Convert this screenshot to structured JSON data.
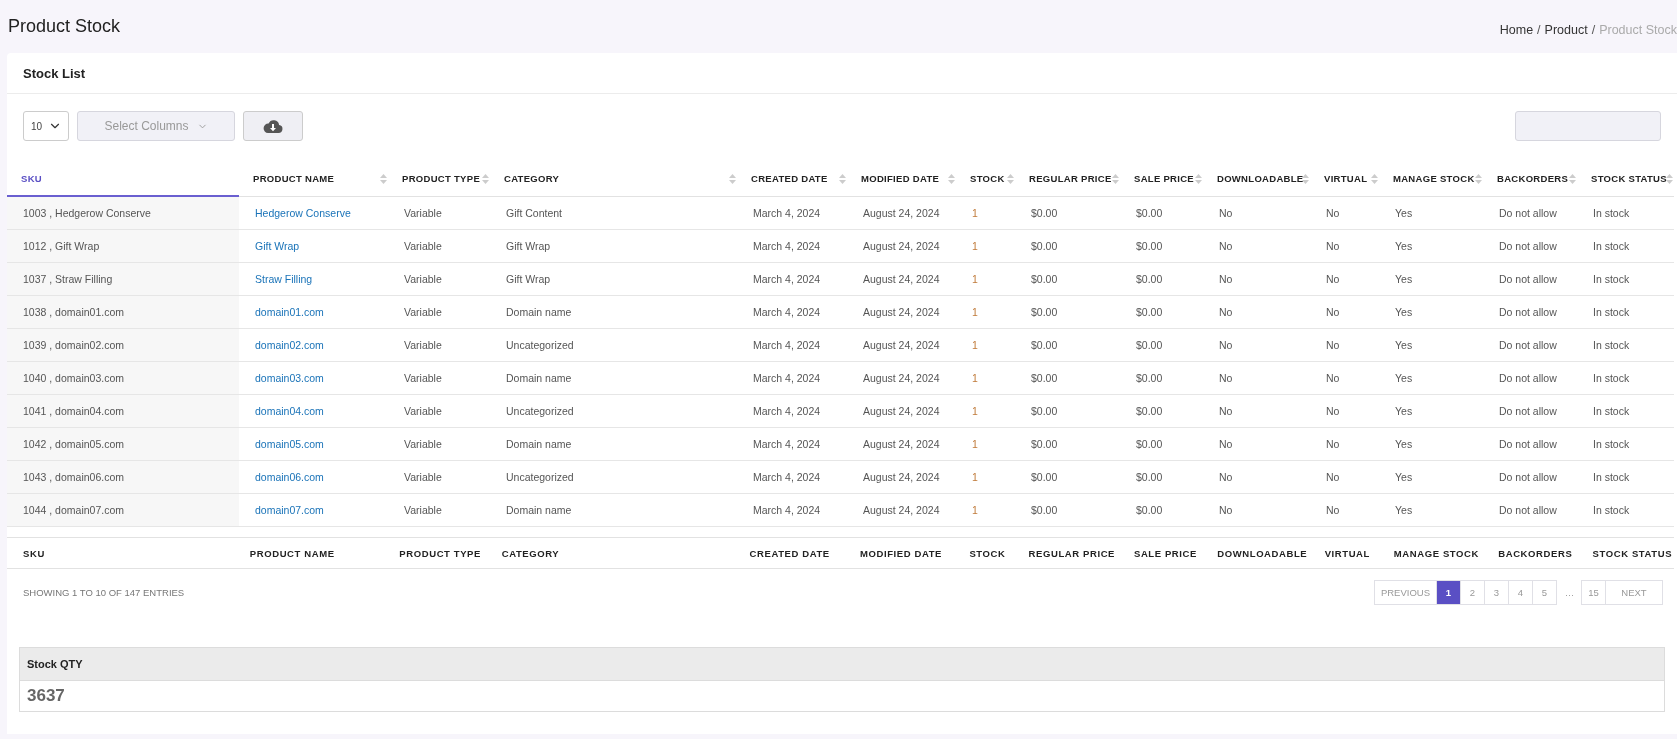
{
  "page_title": "Product Stock",
  "breadcrumb_separator": "/",
  "breadcrumb": [
    {
      "label": "Home",
      "current": false
    },
    {
      "label": "Product",
      "current": false
    },
    {
      "label": "Product Stock",
      "current": true
    }
  ],
  "card_title": "Stock List",
  "toolbar": {
    "page_size": "10",
    "columns_select": {
      "placeholder": "Select Columns"
    }
  },
  "columns": [
    {
      "label": "SKU",
      "kind": "sku",
      "selected": true
    },
    {
      "label": "PRODUCT NAME",
      "kind": "link",
      "selected": false
    },
    {
      "label": "PRODUCT TYPE",
      "kind": "text",
      "selected": false
    },
    {
      "label": "CATEGORY",
      "kind": "text",
      "selected": false
    },
    {
      "label": "CREATED DATE",
      "kind": "text",
      "selected": false
    },
    {
      "label": "MODIFIED DATE",
      "kind": "text",
      "selected": false
    },
    {
      "label": "STOCK",
      "kind": "number",
      "selected": false
    },
    {
      "label": "REGULAR PRICE",
      "kind": "text",
      "selected": false
    },
    {
      "label": "SALE PRICE",
      "kind": "text",
      "selected": false
    },
    {
      "label": "DOWNLOADABLE",
      "kind": "text",
      "selected": false
    },
    {
      "label": "VIRTUAL",
      "kind": "text",
      "selected": false
    },
    {
      "label": "MANAGE STOCK",
      "kind": "text",
      "selected": false
    },
    {
      "label": "BACKORDERS",
      "kind": "text",
      "selected": false
    },
    {
      "label": "STOCK STATUS",
      "kind": "text",
      "selected": false
    }
  ],
  "rows": [
    [
      "1003 , Hedgerow Conserve",
      "Hedgerow Conserve",
      "Variable",
      "Gift Content",
      "March 4, 2024",
      "August 24, 2024",
      "1",
      "$0.00",
      "$0.00",
      "No",
      "No",
      "Yes",
      "Do not allow",
      "In stock"
    ],
    [
      "1012 , Gift Wrap",
      "Gift Wrap",
      "Variable",
      "Gift Wrap",
      "March 4, 2024",
      "August 24, 2024",
      "1",
      "$0.00",
      "$0.00",
      "No",
      "No",
      "Yes",
      "Do not allow",
      "In stock"
    ],
    [
      "1037 , Straw Filling",
      "Straw Filling",
      "Variable",
      "Gift Wrap",
      "March 4, 2024",
      "August 24, 2024",
      "1",
      "$0.00",
      "$0.00",
      "No",
      "No",
      "Yes",
      "Do not allow",
      "In stock"
    ],
    [
      "1038 , domain01.com",
      "domain01.com",
      "Variable",
      "Domain name",
      "March 4, 2024",
      "August 24, 2024",
      "1",
      "$0.00",
      "$0.00",
      "No",
      "No",
      "Yes",
      "Do not allow",
      "In stock"
    ],
    [
      "1039 , domain02.com",
      "domain02.com",
      "Variable",
      "Uncategorized",
      "March 4, 2024",
      "August 24, 2024",
      "1",
      "$0.00",
      "$0.00",
      "No",
      "No",
      "Yes",
      "Do not allow",
      "In stock"
    ],
    [
      "1040 , domain03.com",
      "domain03.com",
      "Variable",
      "Domain name",
      "March 4, 2024",
      "August 24, 2024",
      "1",
      "$0.00",
      "$0.00",
      "No",
      "No",
      "Yes",
      "Do not allow",
      "In stock"
    ],
    [
      "1041 , domain04.com",
      "domain04.com",
      "Variable",
      "Uncategorized",
      "March 4, 2024",
      "August 24, 2024",
      "1",
      "$0.00",
      "$0.00",
      "No",
      "No",
      "Yes",
      "Do not allow",
      "In stock"
    ],
    [
      "1042 , domain05.com",
      "domain05.com",
      "Variable",
      "Domain name",
      "March 4, 2024",
      "August 24, 2024",
      "1",
      "$0.00",
      "$0.00",
      "No",
      "No",
      "Yes",
      "Do not allow",
      "In stock"
    ],
    [
      "1043 , domain06.com",
      "domain06.com",
      "Variable",
      "Uncategorized",
      "March 4, 2024",
      "August 24, 2024",
      "1",
      "$0.00",
      "$0.00",
      "No",
      "No",
      "Yes",
      "Do not allow",
      "In stock"
    ],
    [
      "1044 , domain07.com",
      "domain07.com",
      "Variable",
      "Domain name",
      "March 4, 2024",
      "August 24, 2024",
      "1",
      "$0.00",
      "$0.00",
      "No",
      "No",
      "Yes",
      "Do not allow",
      "In stock"
    ]
  ],
  "footer_columns": [
    "SKU",
    "PRODUCT NAME",
    "PRODUCT TYPE",
    "CATEGORY",
    "CREATED DATE",
    "MODIFIED DATE",
    "STOCK",
    "REGULAR PRICE",
    "SALE PRICE",
    "DOWNLOADABLE",
    "VIRTUAL",
    "MANAGE STOCK",
    "BACKORDERS",
    "STOCK STATUS"
  ],
  "entries_info": "SHOWING 1 TO 10 OF 147 ENTRIES",
  "pagination": [
    {
      "label": "PREVIOUS",
      "kind": "nav",
      "selected": false
    },
    {
      "label": "1",
      "kind": "page",
      "selected": true
    },
    {
      "label": "2",
      "kind": "page",
      "selected": false
    },
    {
      "label": "3",
      "kind": "page",
      "selected": false
    },
    {
      "label": "4",
      "kind": "page",
      "selected": false
    },
    {
      "label": "5",
      "kind": "page",
      "selected": false
    },
    {
      "label": "…",
      "kind": "gap",
      "selected": false
    },
    {
      "label": "15",
      "kind": "page",
      "selected": false
    },
    {
      "label": "NEXT",
      "kind": "nav",
      "selected": false
    }
  ],
  "stock_qty": {
    "label": "Stock QTY",
    "value": "3637"
  }
}
